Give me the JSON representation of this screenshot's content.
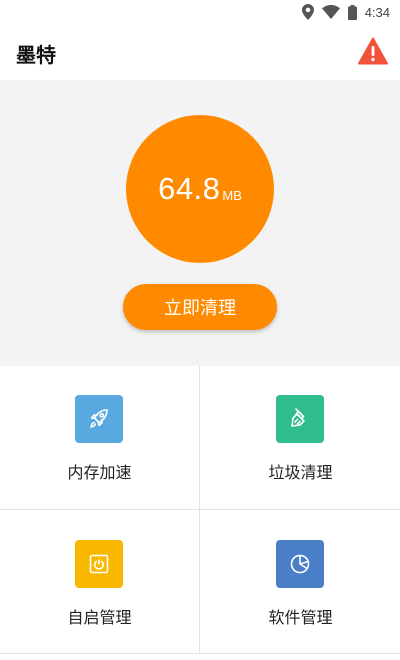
{
  "status_bar": {
    "time": "4:34",
    "icons": [
      "location-icon",
      "wifi-icon",
      "battery-icon"
    ]
  },
  "app_bar": {
    "title": "墨特",
    "warning_icon": "warning-icon"
  },
  "memory": {
    "value": "64.8",
    "unit": "MB"
  },
  "clean_button": {
    "label": "立即清理"
  },
  "grid": [
    {
      "label": "内存加速",
      "icon": "rocket-icon",
      "color": "#5aa8e0"
    },
    {
      "label": "垃圾清理",
      "icon": "broom-icon",
      "color": "#2fbc8f"
    },
    {
      "label": "自启管理",
      "icon": "power-icon",
      "color": "#f8b800"
    },
    {
      "label": "软件管理",
      "icon": "pie-chart-icon",
      "color": "#4a7fc8"
    }
  ],
  "colors": {
    "accent": "#ff8a00",
    "hero_background": "#f3f3f3",
    "warning": "#f0533a"
  }
}
